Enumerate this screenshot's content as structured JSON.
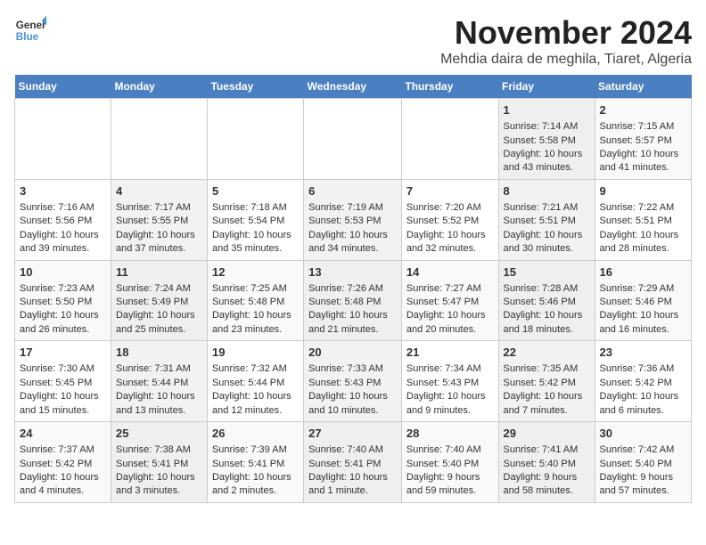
{
  "header": {
    "logo_line1": "General",
    "logo_line2": "Blue",
    "month_title": "November 2024",
    "location": "Mehdia daira de meghila, Tiaret, Algeria"
  },
  "days_of_week": [
    "Sunday",
    "Monday",
    "Tuesday",
    "Wednesday",
    "Thursday",
    "Friday",
    "Saturday"
  ],
  "weeks": [
    [
      {
        "day": "",
        "info": ""
      },
      {
        "day": "",
        "info": ""
      },
      {
        "day": "",
        "info": ""
      },
      {
        "day": "",
        "info": ""
      },
      {
        "day": "",
        "info": ""
      },
      {
        "day": "1",
        "info": "Sunrise: 7:14 AM\nSunset: 5:58 PM\nDaylight: 10 hours and 43 minutes."
      },
      {
        "day": "2",
        "info": "Sunrise: 7:15 AM\nSunset: 5:57 PM\nDaylight: 10 hours and 41 minutes."
      }
    ],
    [
      {
        "day": "3",
        "info": "Sunrise: 7:16 AM\nSunset: 5:56 PM\nDaylight: 10 hours and 39 minutes."
      },
      {
        "day": "4",
        "info": "Sunrise: 7:17 AM\nSunset: 5:55 PM\nDaylight: 10 hours and 37 minutes."
      },
      {
        "day": "5",
        "info": "Sunrise: 7:18 AM\nSunset: 5:54 PM\nDaylight: 10 hours and 35 minutes."
      },
      {
        "day": "6",
        "info": "Sunrise: 7:19 AM\nSunset: 5:53 PM\nDaylight: 10 hours and 34 minutes."
      },
      {
        "day": "7",
        "info": "Sunrise: 7:20 AM\nSunset: 5:52 PM\nDaylight: 10 hours and 32 minutes."
      },
      {
        "day": "8",
        "info": "Sunrise: 7:21 AM\nSunset: 5:51 PM\nDaylight: 10 hours and 30 minutes."
      },
      {
        "day": "9",
        "info": "Sunrise: 7:22 AM\nSunset: 5:51 PM\nDaylight: 10 hours and 28 minutes."
      }
    ],
    [
      {
        "day": "10",
        "info": "Sunrise: 7:23 AM\nSunset: 5:50 PM\nDaylight: 10 hours and 26 minutes."
      },
      {
        "day": "11",
        "info": "Sunrise: 7:24 AM\nSunset: 5:49 PM\nDaylight: 10 hours and 25 minutes."
      },
      {
        "day": "12",
        "info": "Sunrise: 7:25 AM\nSunset: 5:48 PM\nDaylight: 10 hours and 23 minutes."
      },
      {
        "day": "13",
        "info": "Sunrise: 7:26 AM\nSunset: 5:48 PM\nDaylight: 10 hours and 21 minutes."
      },
      {
        "day": "14",
        "info": "Sunrise: 7:27 AM\nSunset: 5:47 PM\nDaylight: 10 hours and 20 minutes."
      },
      {
        "day": "15",
        "info": "Sunrise: 7:28 AM\nSunset: 5:46 PM\nDaylight: 10 hours and 18 minutes."
      },
      {
        "day": "16",
        "info": "Sunrise: 7:29 AM\nSunset: 5:46 PM\nDaylight: 10 hours and 16 minutes."
      }
    ],
    [
      {
        "day": "17",
        "info": "Sunrise: 7:30 AM\nSunset: 5:45 PM\nDaylight: 10 hours and 15 minutes."
      },
      {
        "day": "18",
        "info": "Sunrise: 7:31 AM\nSunset: 5:44 PM\nDaylight: 10 hours and 13 minutes."
      },
      {
        "day": "19",
        "info": "Sunrise: 7:32 AM\nSunset: 5:44 PM\nDaylight: 10 hours and 12 minutes."
      },
      {
        "day": "20",
        "info": "Sunrise: 7:33 AM\nSunset: 5:43 PM\nDaylight: 10 hours and 10 minutes."
      },
      {
        "day": "21",
        "info": "Sunrise: 7:34 AM\nSunset: 5:43 PM\nDaylight: 10 hours and 9 minutes."
      },
      {
        "day": "22",
        "info": "Sunrise: 7:35 AM\nSunset: 5:42 PM\nDaylight: 10 hours and 7 minutes."
      },
      {
        "day": "23",
        "info": "Sunrise: 7:36 AM\nSunset: 5:42 PM\nDaylight: 10 hours and 6 minutes."
      }
    ],
    [
      {
        "day": "24",
        "info": "Sunrise: 7:37 AM\nSunset: 5:42 PM\nDaylight: 10 hours and 4 minutes."
      },
      {
        "day": "25",
        "info": "Sunrise: 7:38 AM\nSunset: 5:41 PM\nDaylight: 10 hours and 3 minutes."
      },
      {
        "day": "26",
        "info": "Sunrise: 7:39 AM\nSunset: 5:41 PM\nDaylight: 10 hours and 2 minutes."
      },
      {
        "day": "27",
        "info": "Sunrise: 7:40 AM\nSunset: 5:41 PM\nDaylight: 10 hours and 1 minute."
      },
      {
        "day": "28",
        "info": "Sunrise: 7:40 AM\nSunset: 5:40 PM\nDaylight: 9 hours and 59 minutes."
      },
      {
        "day": "29",
        "info": "Sunrise: 7:41 AM\nSunset: 5:40 PM\nDaylight: 9 hours and 58 minutes."
      },
      {
        "day": "30",
        "info": "Sunrise: 7:42 AM\nSunset: 5:40 PM\nDaylight: 9 hours and 57 minutes."
      }
    ]
  ]
}
